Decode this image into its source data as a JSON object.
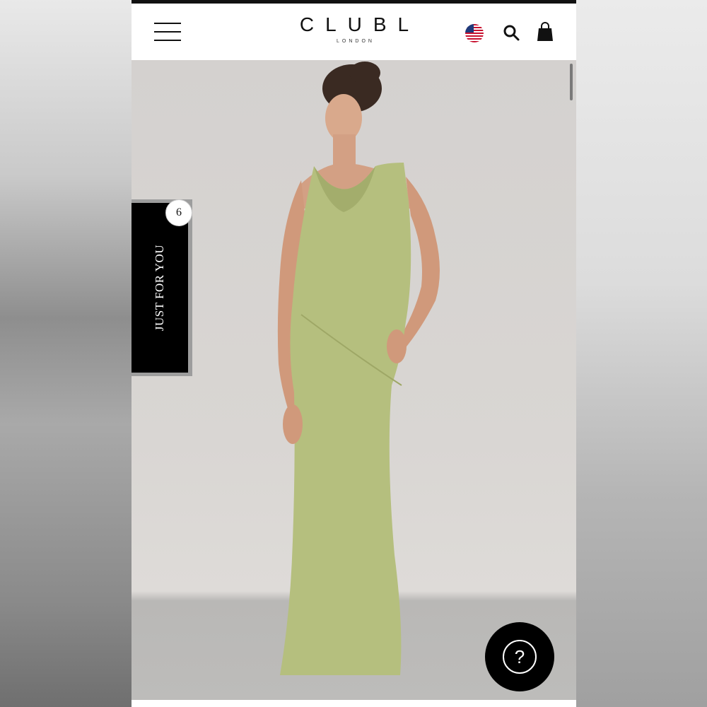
{
  "header": {
    "logo_main": "CLUBL",
    "logo_sub": "LONDON",
    "menu_icon": "hamburger-menu-icon",
    "flag_icon": "us-flag-icon",
    "search_icon": "search-icon",
    "bag_icon": "shopping-bag-icon"
  },
  "hero": {
    "image": "model-green-satin-maxi-dress"
  },
  "just_for_you": {
    "label": "JUST FOR YOU",
    "count": "6"
  },
  "help": {
    "icon": "question-mark-icon",
    "glyph": "?"
  },
  "colors": {
    "dress": "#b5bf7e",
    "header_bg": "#ffffff",
    "accent": "#000000"
  }
}
